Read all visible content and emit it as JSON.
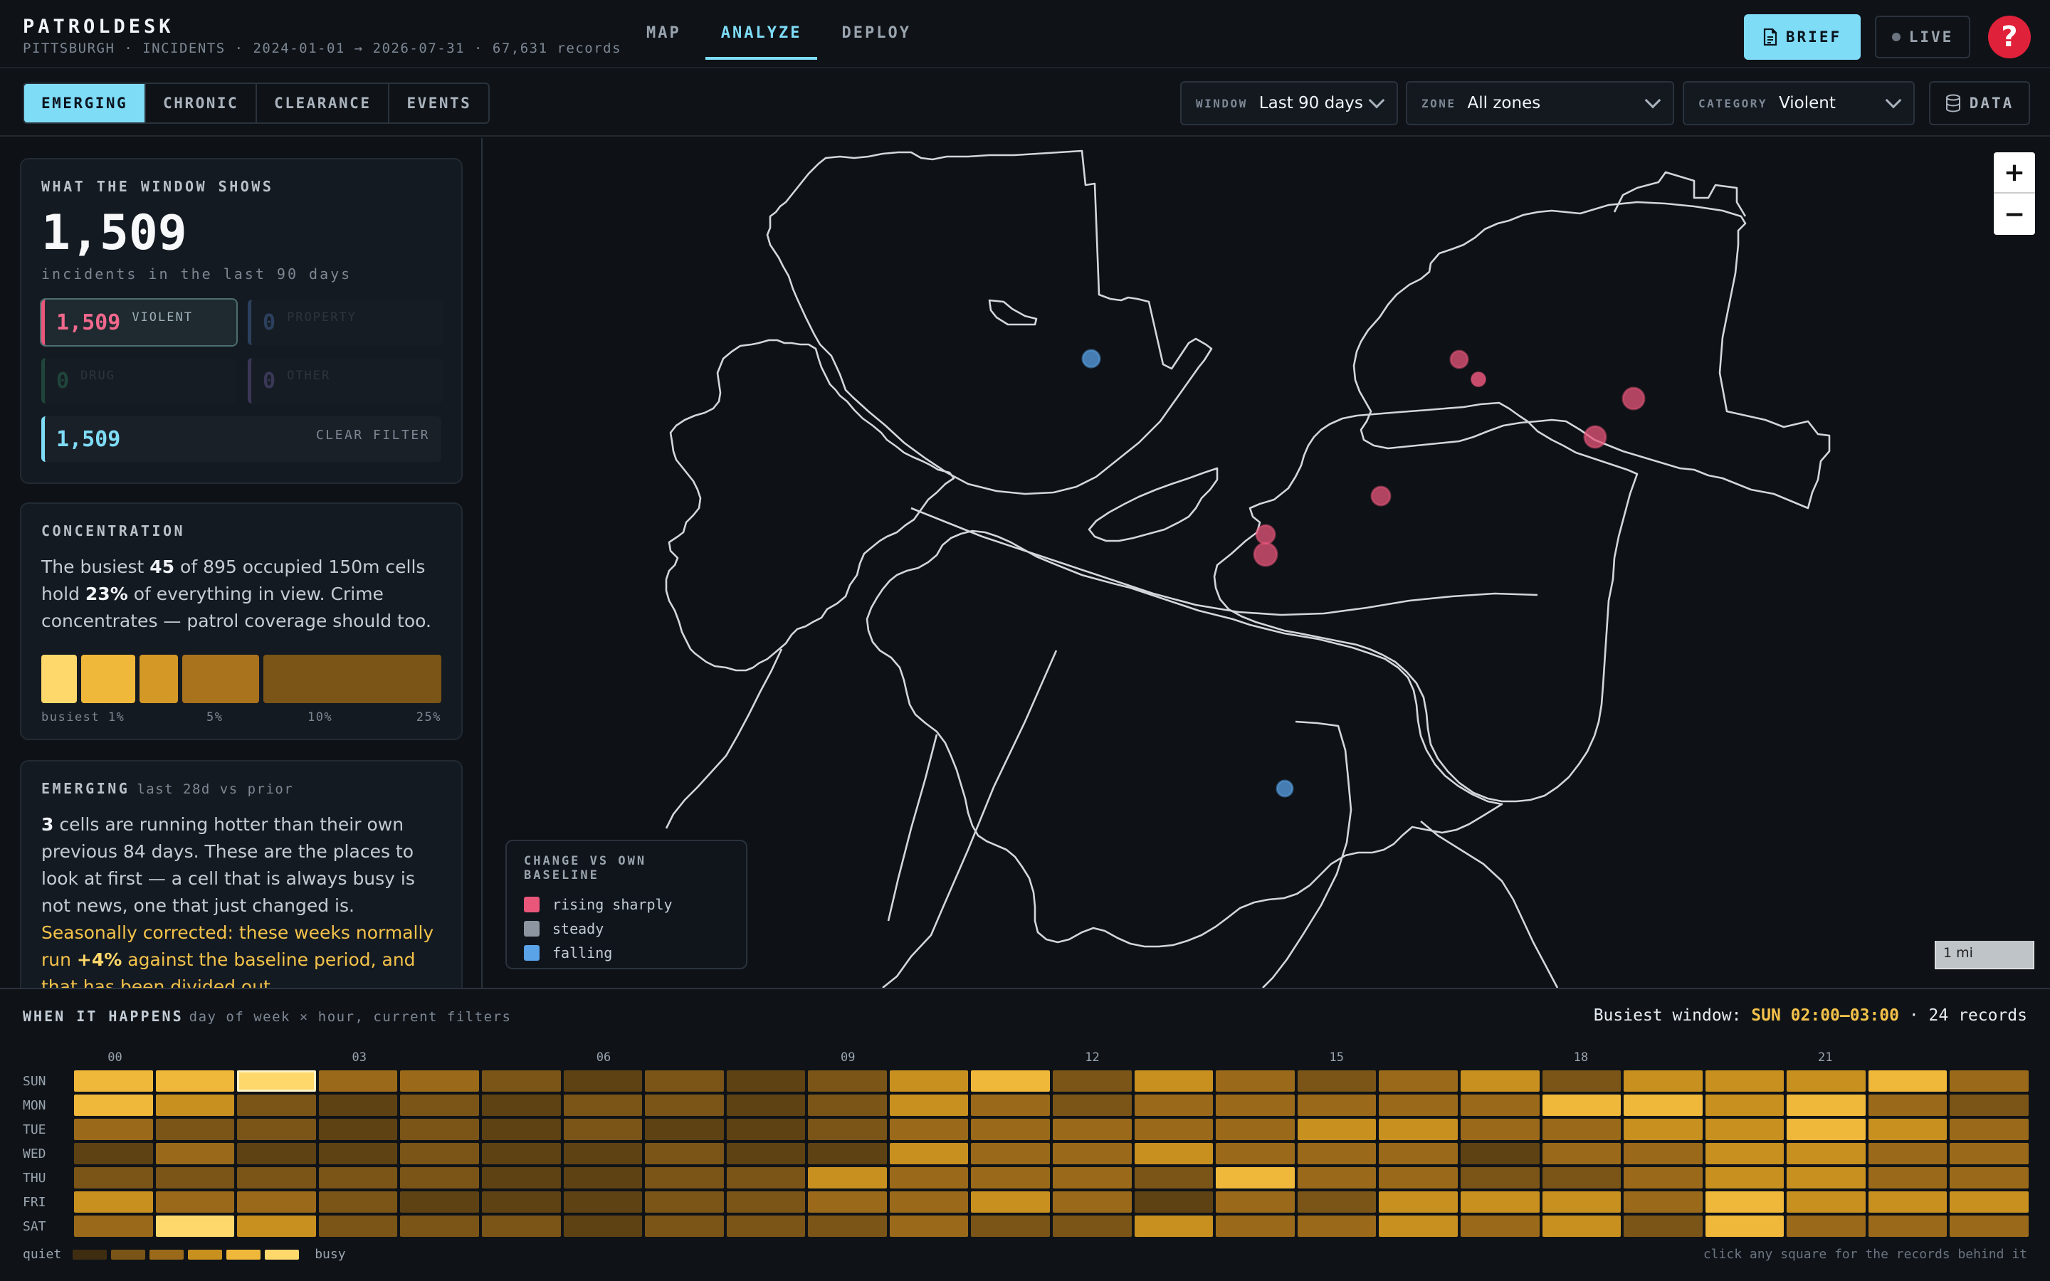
{
  "app": {
    "name": "PATROLDESK",
    "subtitle": "PITTSBURGH · INCIDENTS · 2024-01-01 → 2026-07-31 · 67,631 records"
  },
  "nav": {
    "tabs": [
      {
        "label": "MAP",
        "active": false
      },
      {
        "label": "ANALYZE",
        "active": true
      },
      {
        "label": "DEPLOY",
        "active": false
      }
    ]
  },
  "header_actions": {
    "brief_label": "BRIEF",
    "live_label": "LIVE",
    "help_label": "?"
  },
  "modes": [
    {
      "label": "EMERGING",
      "active": true
    },
    {
      "label": "CHRONIC",
      "active": false
    },
    {
      "label": "CLEARANCE",
      "active": false
    },
    {
      "label": "EVENTS",
      "active": false
    }
  ],
  "filters": {
    "window": {
      "label": "WINDOW",
      "value": "Last 90 days"
    },
    "zone": {
      "label": "ZONE",
      "value": "All zones"
    },
    "category": {
      "label": "CATEGORY",
      "value": "Violent"
    },
    "data_label": "DATA"
  },
  "window_card": {
    "title": "WHAT THE WINDOW SHOWS",
    "total": "1,509",
    "caption": "incidents in the last 90 days",
    "chips": [
      {
        "key": "violent",
        "count": "1,509",
        "label": "VIOLENT"
      },
      {
        "key": "property",
        "count": "0",
        "label": "PROPERTY"
      },
      {
        "key": "drug",
        "count": "0",
        "label": "DRUG"
      },
      {
        "key": "other",
        "count": "0",
        "label": "OTHER"
      }
    ],
    "filtered_total": "1,509",
    "clear_label": "CLEAR FILTER"
  },
  "concentration": {
    "title": "CONCENTRATION",
    "text_a": "The busiest ",
    "cells_top": "45",
    "text_b": " of 895 occupied 150m cells hold ",
    "share": "23%",
    "text_c": " of everything in view. Crime concentrates — patrol coverage should too.",
    "ticks": [
      "busiest 1%",
      "5%",
      "10%",
      "25%"
    ]
  },
  "emerging": {
    "title": "EMERGING",
    "subtitle": "last 28d vs prior",
    "count": "3",
    "text_a": " cells are running hotter than their own previous 84 days. These are the places to look at first — a cell that is always busy is not news, one that just changed is. ",
    "seasonal_a": "Seasonally corrected: these weeks normally run ",
    "seasonal_pct": "+4%",
    "seasonal_b": " against the baseline period, and that has been divided out."
  },
  "map": {
    "zoom_in": "+",
    "zoom_out": "−",
    "legend": {
      "title": "CHANGE VS OWN BASELINE",
      "items": [
        {
          "label": "rising sharply",
          "color": "#e8567a"
        },
        {
          "label": "steady",
          "color": "#8d96a0"
        },
        {
          "label": "falling",
          "color": "#5aa3e8"
        }
      ]
    },
    "scale_label": "1 mi"
  },
  "heatmap": {
    "title": "WHEN IT HAPPENS",
    "subtitle": "day of week × hour, current filters",
    "busiest_prefix": "Busiest window: ",
    "busiest_value": "SUN 02:00–03:00",
    "busiest_suffix": " · 24 records",
    "hour_labels": [
      "00",
      "03",
      "06",
      "09",
      "12",
      "15",
      "18",
      "21"
    ],
    "days": [
      "SUN",
      "MON",
      "TUE",
      "WED",
      "THU",
      "FRI",
      "SAT"
    ],
    "legend_quiet": "quiet",
    "legend_busy": "busy",
    "hint": "click any square for the records behind it",
    "palette": [
      "#3f2d12",
      "#5e4214",
      "#7a5517",
      "#9a6a1a",
      "#c8901f",
      "#efb83a",
      "#ffd86b"
    ],
    "levels": [
      [
        5,
        5,
        6,
        3,
        3,
        2,
        1,
        2,
        1,
        2,
        4,
        5,
        2,
        4,
        3,
        2,
        3,
        4,
        2,
        4,
        4,
        4,
        5,
        3
      ],
      [
        5,
        4,
        2,
        1,
        2,
        1,
        2,
        2,
        1,
        2,
        4,
        3,
        2,
        3,
        3,
        3,
        3,
        3,
        5,
        5,
        4,
        5,
        3,
        2
      ],
      [
        3,
        2,
        2,
        1,
        2,
        1,
        2,
        1,
        1,
        2,
        3,
        3,
        3,
        3,
        3,
        4,
        4,
        3,
        3,
        4,
        4,
        5,
        4,
        3
      ],
      [
        1,
        3,
        1,
        1,
        2,
        1,
        1,
        2,
        1,
        1,
        4,
        3,
        3,
        4,
        3,
        3,
        3,
        1,
        3,
        3,
        4,
        4,
        3,
        3
      ],
      [
        2,
        2,
        2,
        2,
        2,
        1,
        1,
        2,
        2,
        4,
        3,
        3,
        3,
        2,
        5,
        3,
        3,
        2,
        2,
        3,
        4,
        4,
        3,
        3
      ],
      [
        4,
        3,
        3,
        2,
        1,
        1,
        1,
        2,
        2,
        3,
        3,
        4,
        3,
        1,
        3,
        2,
        4,
        4,
        4,
        3,
        5,
        4,
        4,
        4
      ],
      [
        3,
        6,
        4,
        2,
        2,
        2,
        1,
        2,
        2,
        2,
        3,
        2,
        2,
        4,
        3,
        3,
        4,
        3,
        4,
        2,
        5,
        3,
        3,
        3
      ]
    ],
    "busiest_cell": {
      "day": 0,
      "hour": 2
    }
  }
}
